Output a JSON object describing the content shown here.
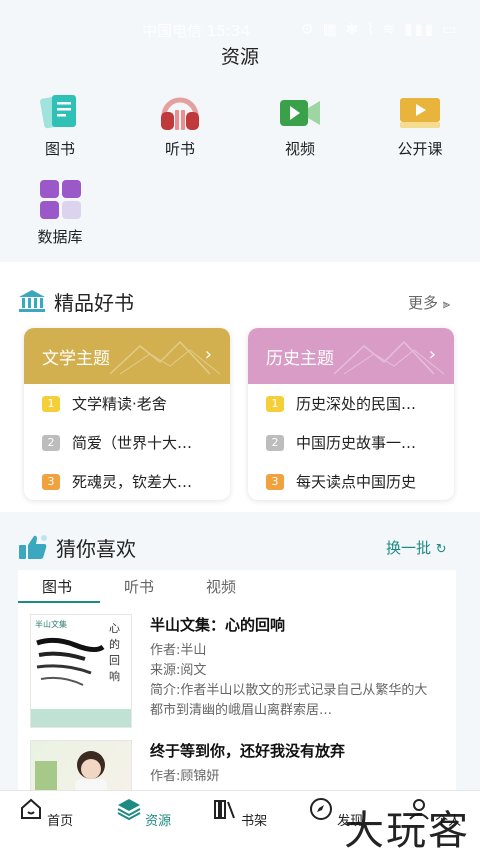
{
  "status_bar": {
    "carrier_time": "中国电信 15:34",
    "icons": "⚙ ▦ ✱ ⌇ ≋ ▮▮▮ ▭"
  },
  "header": {
    "title": "资源"
  },
  "resources": [
    {
      "label": "图书",
      "icon": "book-icon"
    },
    {
      "label": "听书",
      "icon": "headphones-icon"
    },
    {
      "label": "视频",
      "icon": "video-camera-icon"
    },
    {
      "label": "公开课",
      "icon": "open-class-icon"
    },
    {
      "label": "数据库",
      "icon": "database-grid-icon"
    }
  ],
  "featured": {
    "title": "精品好书",
    "more": "更多",
    "cards": [
      {
        "title": "文学主题",
        "color": "#d2b04f",
        "items": [
          {
            "rank": "1",
            "text": "文学精读·老舍"
          },
          {
            "rank": "2",
            "text": "简爱（世界十大…"
          },
          {
            "rank": "3",
            "text": "死魂灵，钦差大…"
          }
        ]
      },
      {
        "title": "历史主题",
        "color": "#d99cc6",
        "items": [
          {
            "rank": "1",
            "text": "历史深处的民国…"
          },
          {
            "rank": "2",
            "text": "中国历史故事一…"
          },
          {
            "rank": "3",
            "text": "每天读点中国历史"
          }
        ]
      }
    ]
  },
  "recommend": {
    "title": "猜你喜欢",
    "refresh": "换一批",
    "tabs": [
      "图书",
      "听书",
      "视频"
    ],
    "books": [
      {
        "title": "半山文集：心的回响",
        "author": "作者:半山",
        "source": "来源:阅文",
        "intro": "简介:作者半山以散文的形式记录自己从繁华的大都市到清幽的峨眉山离群索居…",
        "cover_text": [
          "半山文集",
          "心",
          "的",
          "回",
          "响"
        ]
      },
      {
        "title": "终于等到你，还好我没有放弃",
        "author": "作者:顾锦妍"
      }
    ]
  },
  "bottom_nav": [
    {
      "label": "首页",
      "icon": "home-icon"
    },
    {
      "label": "资源",
      "icon": "layers-icon"
    },
    {
      "label": "书架",
      "icon": "bookshelf-icon"
    },
    {
      "label": "发现",
      "icon": "compass-icon"
    },
    {
      "label": "个人",
      "icon": "person-icon"
    }
  ],
  "watermark": "大玩客",
  "accent": "#1e8a84"
}
